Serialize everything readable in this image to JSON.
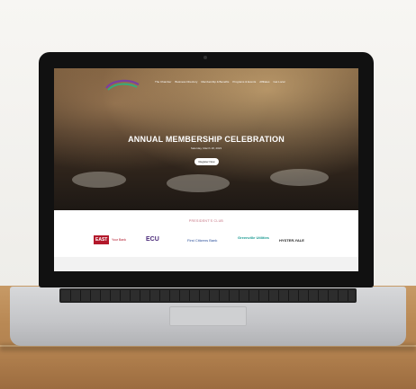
{
  "website": {
    "nav": [
      "The Chamber",
      "Business Directory",
      "Membership & Benefits",
      "Programs & Events",
      "Affiliates",
      "Get Local"
    ],
    "hero": {
      "title": "ANNUAL MEMBERSHIP CELEBRATION",
      "date": "Saturday, March 18, 2023",
      "button_label": "Register Now"
    },
    "club": {
      "title": "PRESIDENT'S CLUB",
      "sponsors": [
        {
          "label": "EAST",
          "sub": "Your Bank",
          "color": "#b3182b"
        },
        {
          "label": "ECU",
          "color": "#4b2a7a"
        },
        {
          "label": "First Citizens Bank",
          "color": "#2b4f9a"
        },
        {
          "label": "Greenville Utilities",
          "color": "#1c9b92"
        },
        {
          "label": "HYSTER-YALE",
          "color": "#222222"
        }
      ]
    }
  },
  "colors": {
    "accent": "#c26b7a"
  }
}
